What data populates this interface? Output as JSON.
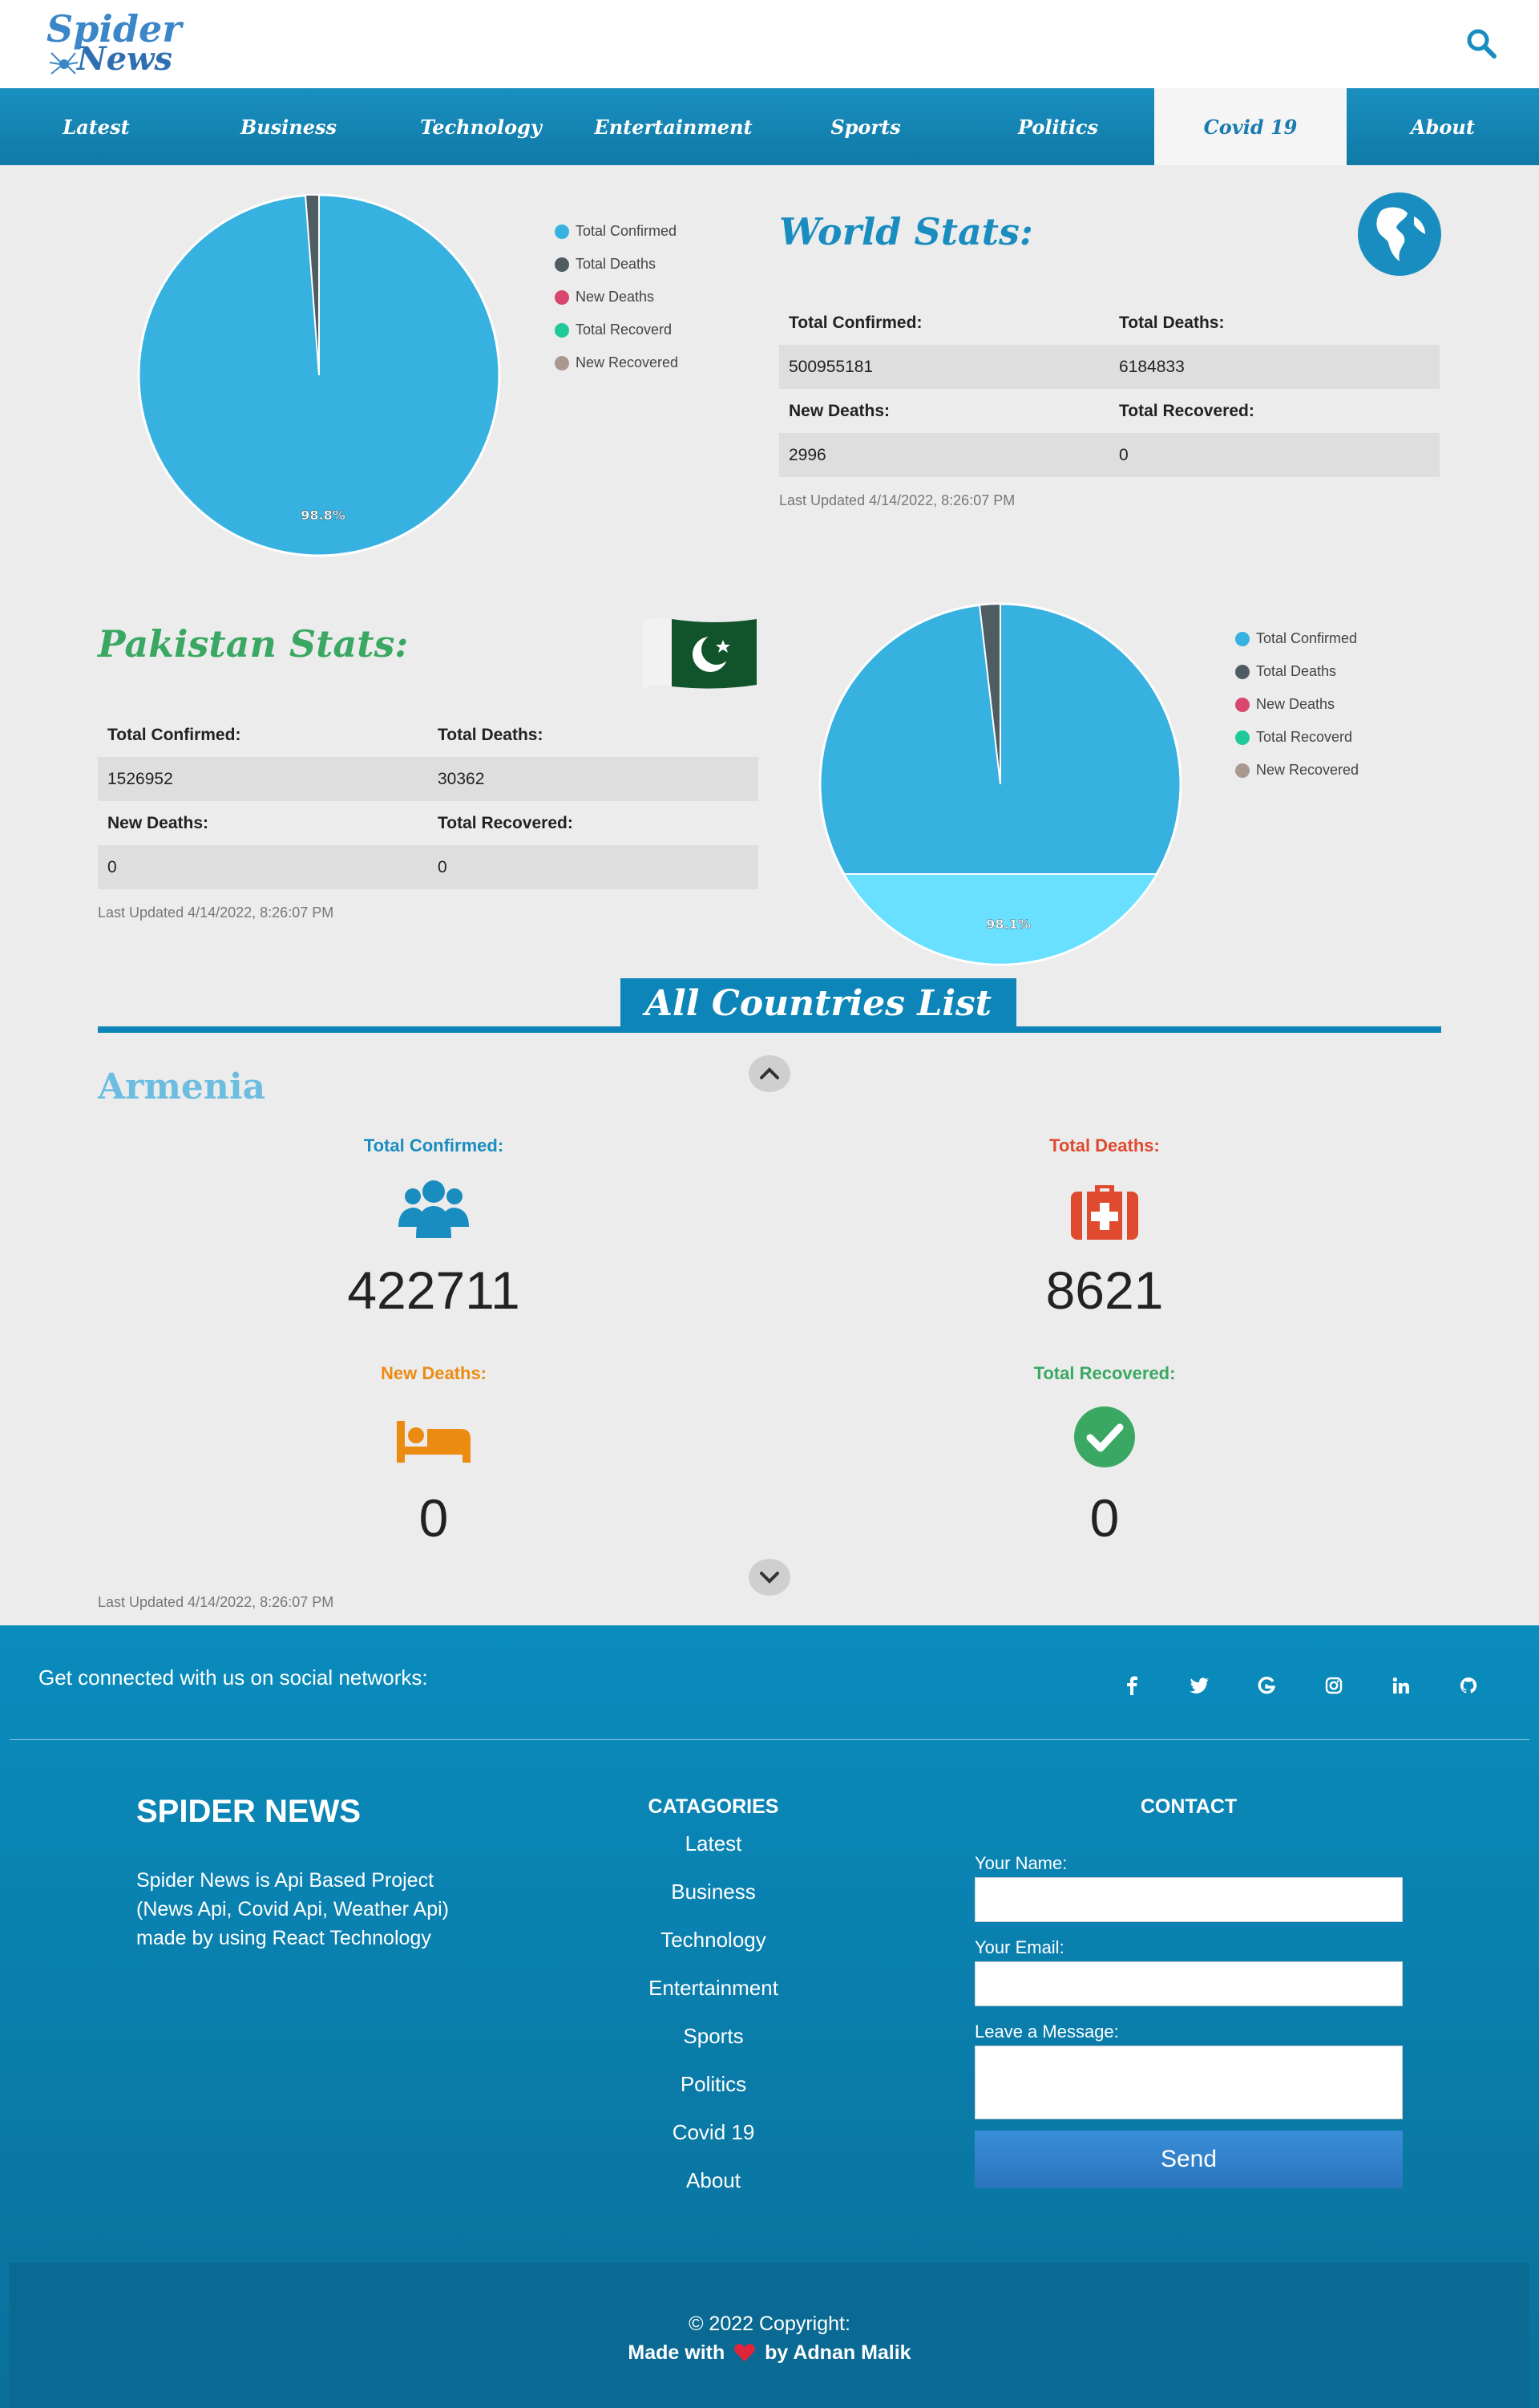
{
  "header": {
    "logo_top": "Spider",
    "logo_bottom": "News",
    "nav": [
      "Latest",
      "Business",
      "Technology",
      "Entertainment",
      "Sports",
      "Politics",
      "Covid 19",
      "About"
    ],
    "active_nav": "Covid 19"
  },
  "legend": [
    "Total Confirmed",
    "Total Deaths",
    "New Deaths",
    "Total Recoverd",
    "New Recovered"
  ],
  "colors": {
    "confirmed": "#36b1e0",
    "deaths": "#4f5d63",
    "new_deaths": "#d9466e",
    "recovered": "#1fc999",
    "new_recovered": "#a89890",
    "brand_blue": "#0d85b9"
  },
  "world": {
    "title": "World Stats:",
    "labels": {
      "total_confirmed": "Total Confirmed:",
      "total_deaths": "Total Deaths:",
      "new_deaths": "New Deaths:",
      "total_recovered": "Total Recovered:"
    },
    "total_confirmed": "500955181",
    "total_deaths": "6184833",
    "new_deaths": "2996",
    "total_recovered": "0",
    "updated": "Last Updated 4/14/2022, 8:26:07 PM",
    "pie_label": "98.8%"
  },
  "pakistan": {
    "title": "Pakistan Stats:",
    "labels": {
      "total_confirmed": "Total Confirmed:",
      "total_deaths": "Total Deaths:",
      "new_deaths": "New Deaths:",
      "total_recovered": "Total Recovered:"
    },
    "total_confirmed": "1526952",
    "total_deaths": "30362",
    "new_deaths": "0",
    "total_recovered": "0",
    "updated": "Last Updated 4/14/2022, 8:26:07 PM",
    "pie_label": "98.1%"
  },
  "countries": {
    "title": "All Countries List",
    "name": "Armenia",
    "total_confirmed_label": "Total Confirmed:",
    "total_confirmed": "422711",
    "total_deaths_label": "Total Deaths:",
    "total_deaths": "8621",
    "new_deaths_label": "New Deaths:",
    "new_deaths": "0",
    "total_recovered_label": "Total Recovered:",
    "total_recovered": "0",
    "updated": "Last Updated 4/14/2022, 8:26:07 PM",
    "label_colors": {
      "confirmed": "#1a8dc0",
      "deaths": "#e04a2e",
      "new_deaths": "#ec8b12",
      "recovered": "#3aa862"
    }
  },
  "footer": {
    "social_text": "Get connected with us on social networks:",
    "social_icons": [
      "facebook-icon",
      "twitter-icon",
      "google-icon",
      "instagram-icon",
      "linkedin-icon",
      "github-icon"
    ],
    "brand": "SPIDER NEWS",
    "brand_desc": "Spider News is Api Based Project (News Api, Covid Api, Weather Api) made by using React Technology",
    "categories_title": "CATAGORIES",
    "categories": [
      "Latest",
      "Business",
      "Technology",
      "Entertainment",
      "Sports",
      "Politics",
      "Covid 19",
      "About"
    ],
    "contact_title": "CONTACT",
    "name_label": "Your Name:",
    "email_label": "Your Email:",
    "message_label": "Leave a Message:",
    "send": "Send",
    "copyright": "© 2022 Copyright:",
    "made_with": "Made with",
    "by": "by Adnan Malik"
  }
}
